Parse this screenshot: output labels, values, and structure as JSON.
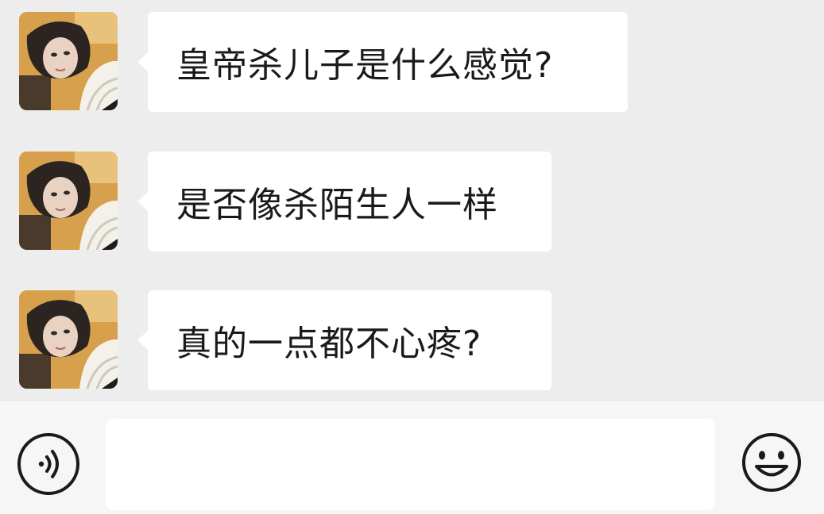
{
  "messages": [
    {
      "sender": "avatar-photo",
      "text": "皇帝杀儿子是什么感觉?"
    },
    {
      "sender": "avatar-photo",
      "text": "是否像杀陌生人一样"
    },
    {
      "sender": "avatar-photo",
      "text": "真的一点都不心疼?"
    }
  ],
  "input_bar": {
    "voice_icon": "voice-icon",
    "input_value": "",
    "emoji_icon": "smiley-face-icon"
  },
  "colors": {
    "chat_background": "#ededed",
    "bubble_background": "#ffffff",
    "input_bar_background": "#f6f6f6",
    "text": "#1a1a1a"
  }
}
